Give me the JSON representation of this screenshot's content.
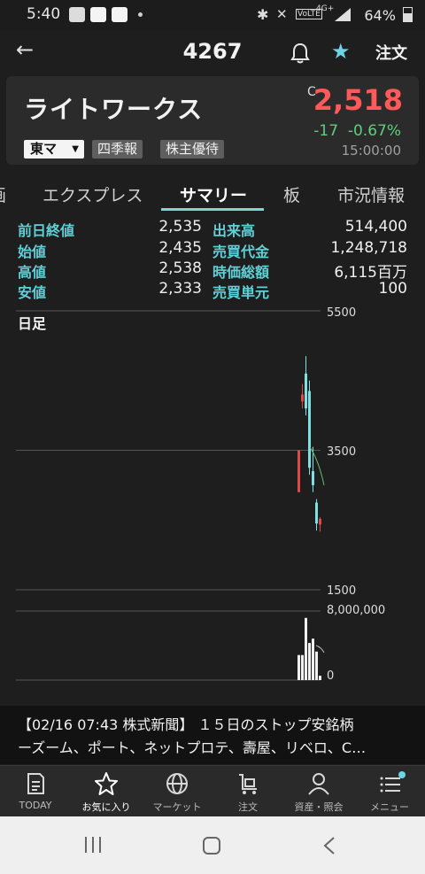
{
  "status_bar": {
    "time": "5:40",
    "battery": "64%",
    "network": "4G+",
    "volte": "VoLTE"
  },
  "header": {
    "title": "4267",
    "order_label": "注文"
  },
  "stock": {
    "name": "ライトワークス",
    "market": "東マ",
    "tags": [
      "四季報",
      "株主優待"
    ],
    "price_mark": "C",
    "price": "2,518",
    "change": "-17",
    "change_pct": "-0.67%",
    "time": "15:00:00",
    "colors": {
      "price": "#ff5a5a",
      "change": "#5fcf7a",
      "accent": "#7cd6d8"
    }
  },
  "tabs": [
    "画",
    "エクスプレス",
    "サマリー",
    "板",
    "市況情報"
  ],
  "active_tab": "サマリー",
  "summary": {
    "left": [
      {
        "label": "前日終値",
        "value": "2,535"
      },
      {
        "label": "始値",
        "value": "2,435"
      },
      {
        "label": "高値",
        "value": "2,538"
      },
      {
        "label": "安値",
        "value": "2,333"
      }
    ],
    "right": [
      {
        "label": "出来高",
        "value": "514,400"
      },
      {
        "label": "売買代金",
        "value": "1,248,718"
      },
      {
        "label": "時価総額",
        "value": "6,115百万"
      },
      {
        "label": "売買単元",
        "value": "100"
      }
    ]
  },
  "chart": {
    "title": "日足",
    "price_axis": [
      "5500",
      "3500",
      "1500"
    ],
    "volume_axis": [
      "8,000,000",
      "0"
    ]
  },
  "chart_data": {
    "type": "candlestick",
    "title": "日足",
    "price_ylim": [
      1500,
      5500
    ],
    "volume_ylim": [
      0,
      8000000
    ],
    "candles": [
      {
        "open": 3500,
        "close": 2900,
        "high": 3500,
        "low": 2900,
        "up": true
      },
      {
        "open": 4300,
        "close": 4200,
        "high": 4450,
        "low": 4100,
        "up": true
      },
      {
        "open": 4100,
        "close": 4600,
        "high": 4850,
        "low": 4000,
        "up": false
      },
      {
        "open": 4350,
        "close": 3250,
        "high": 4500,
        "low": 3150,
        "up": false
      },
      {
        "open": 3200,
        "close": 3000,
        "high": 3550,
        "low": 2900,
        "up": false
      },
      {
        "open": 2750,
        "close": 2450,
        "high": 2800,
        "low": 2350,
        "up": false
      },
      {
        "open": 2435,
        "close": 2518,
        "high": 2538,
        "low": 2333,
        "up": true
      }
    ],
    "volume": [
      2900000,
      2900000,
      7200000,
      4300000,
      4800000,
      3300000,
      500000
    ]
  },
  "news": {
    "line1": "【02/16 07:43 株式新聞】 １５日のストップ安銘柄",
    "line2": "ーズーム、ポート、ネットプロテ、壽屋、リベロ、C…"
  },
  "bottom_nav": [
    {
      "label": "TODAY",
      "icon": "newspaper-icon"
    },
    {
      "label": "お気に入り",
      "icon": "star-icon"
    },
    {
      "label": "マーケット",
      "icon": "globe-icon"
    },
    {
      "label": "注文",
      "icon": "cart-icon"
    },
    {
      "label": "資産・照会",
      "icon": "person-icon"
    },
    {
      "label": "メニュー",
      "icon": "menu-icon"
    }
  ],
  "selected_nav": "お気に入り"
}
